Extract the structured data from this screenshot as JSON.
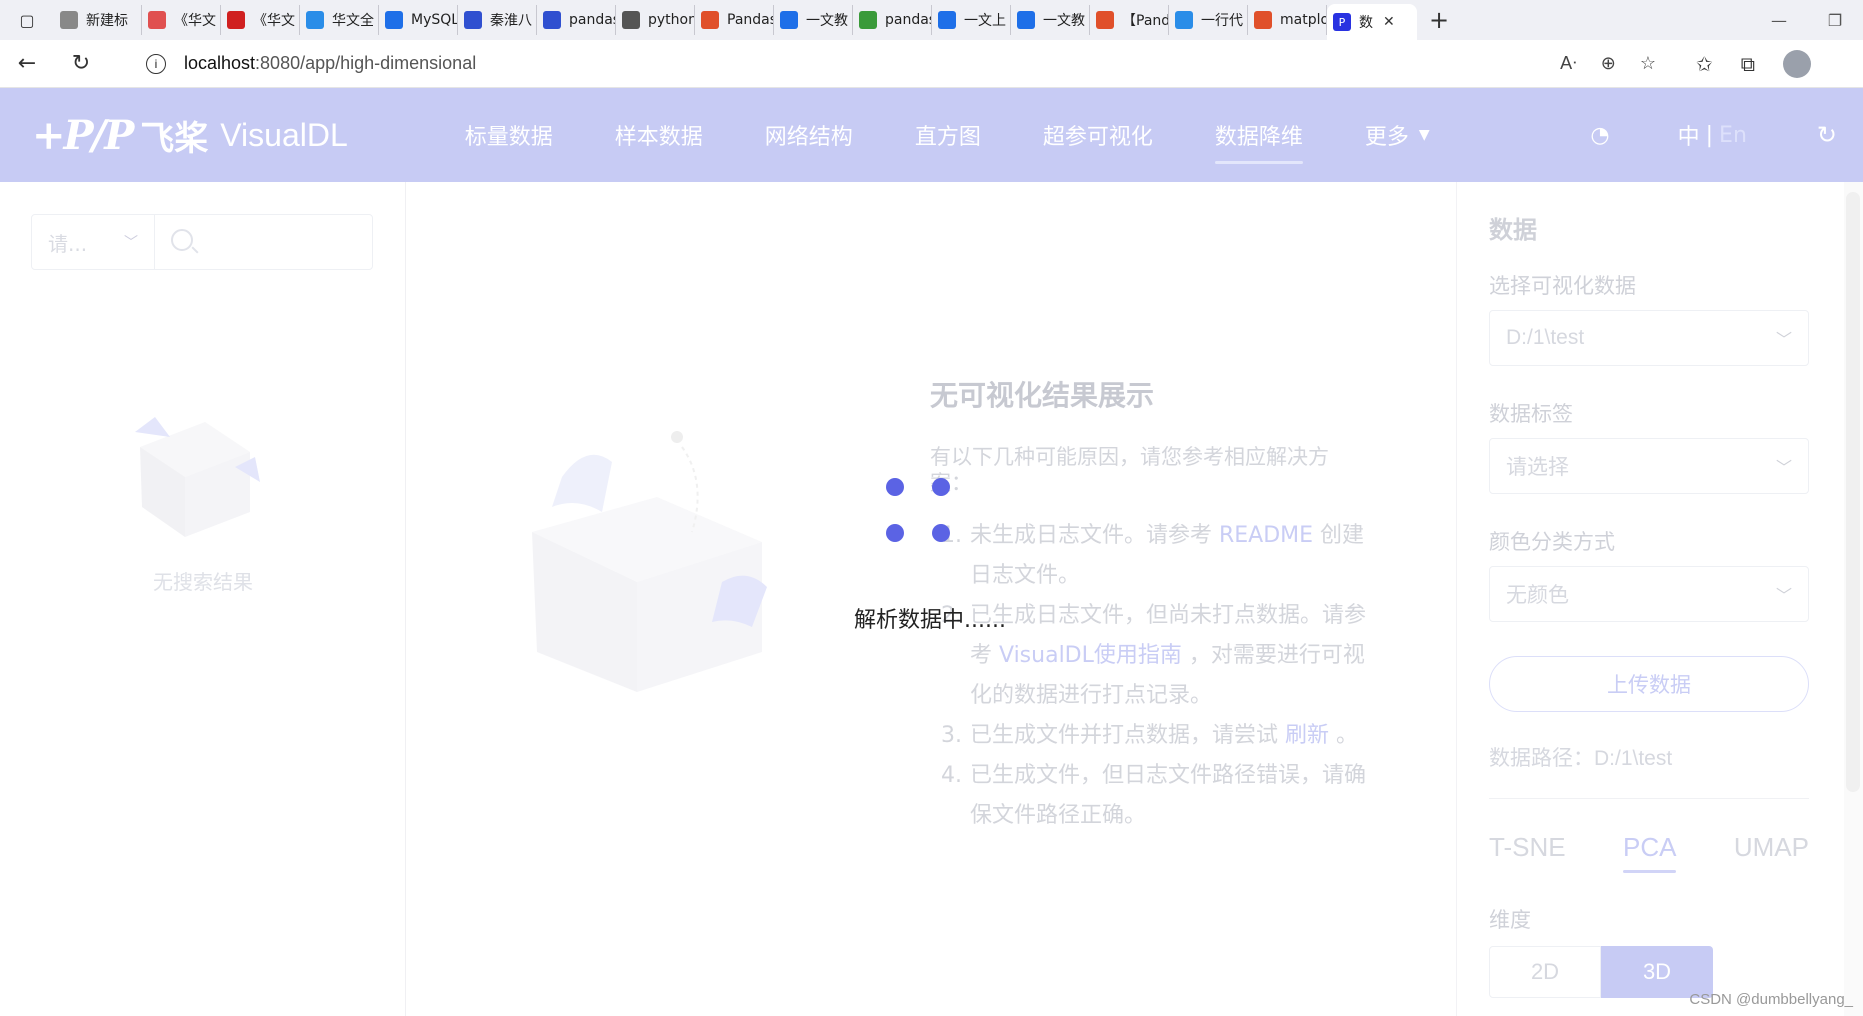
{
  "browser": {
    "tabs": [
      {
        "label": "新建标",
        "icon": "new-tab-icon",
        "color": "#888888"
      },
      {
        "label": "《华文",
        "icon": "book-icon",
        "color": "#e05050"
      },
      {
        "label": "《华文",
        "icon": "book-icon",
        "color": "#d02020"
      },
      {
        "label": "华文全",
        "icon": "cloud-icon",
        "color": "#2a8de8"
      },
      {
        "label": "MySQL",
        "icon": "zhihu-icon",
        "color": "#1e6fe8"
      },
      {
        "label": "秦淮八",
        "icon": "baidu-paw-icon",
        "color": "#3050d0"
      },
      {
        "label": "pandas",
        "icon": "baidu-paw-icon",
        "color": "#3050d0"
      },
      {
        "label": "python",
        "icon": "script-icon",
        "color": "#555555"
      },
      {
        "label": "Pandas",
        "icon": "csdn-icon",
        "color": "#e0502a"
      },
      {
        "label": "一文教",
        "icon": "zhihu-icon",
        "color": "#1e6fe8"
      },
      {
        "label": "pandas",
        "icon": "g-icon",
        "color": "#3a9a3a"
      },
      {
        "label": "一文上",
        "icon": "zhihu-icon",
        "color": "#1e6fe8"
      },
      {
        "label": "一文教",
        "icon": "zhihu-icon",
        "color": "#1e6fe8"
      },
      {
        "label": "【Pand",
        "icon": "csdn-icon",
        "color": "#e0502a"
      },
      {
        "label": "一行代",
        "icon": "cloud-icon",
        "color": "#2a8de8"
      },
      {
        "label": "matplo",
        "icon": "csdn-icon",
        "color": "#e0502a"
      }
    ],
    "active_tab": {
      "label": "数",
      "icon": "paddle-icon",
      "color": "#2932e1"
    },
    "new_tab_label": "+",
    "url_host": "localhost",
    "url_path": ":8080/app/high-dimensional"
  },
  "header": {
    "logo_mark": "+P/P",
    "brand_cn": "飞桨",
    "brand_en": "VisualDL",
    "nav": [
      {
        "label": "标量数据",
        "active": false
      },
      {
        "label": "样本数据",
        "active": false
      },
      {
        "label": "网络结构",
        "active": false
      },
      {
        "label": "直方图",
        "active": false
      },
      {
        "label": "超参可视化",
        "active": false
      },
      {
        "label": "数据降维",
        "active": true
      },
      {
        "label": "更多",
        "active": false
      }
    ],
    "lang_zh": "中",
    "lang_sep": "|",
    "lang_en": "En"
  },
  "left_panel": {
    "select_placeholder": "请...",
    "empty_text": "无搜索结果"
  },
  "main": {
    "title": "无可视化结果展示",
    "intro": "有以下几种可能原因，请您参考相应解决方案：",
    "reasons": [
      {
        "num": "1.",
        "pre": "未生成日志文件。请参考 ",
        "link": "README",
        "post": " 创建日志文件。"
      },
      {
        "num": "2.",
        "pre": "已生成日志文件，但尚未打点数据。请参考 ",
        "link": "VisualDL使用指南",
        "post": " ，对需要进行可视化的数据进行打点记录。"
      },
      {
        "num": "3.",
        "pre": "已生成文件并打点数据，请尝试 ",
        "link": "刷新",
        "post": " 。"
      },
      {
        "num": "4.",
        "pre": "已生成文件，但日志文件路径错误，请确保文件路径正确。",
        "link": "",
        "post": ""
      }
    ],
    "loading_text": "解析数据中......"
  },
  "right_panel": {
    "title": "数据",
    "select_data_label": "选择可视化数据",
    "select_data_value": "D:/1\\test",
    "label_label": "数据标签",
    "label_value": "请选择",
    "color_label": "颜色分类方式",
    "color_value": "无颜色",
    "upload_button": "上传数据",
    "data_path": "数据路径：D:/1\\test",
    "algorithms": [
      {
        "label": "T-SNE",
        "active": false
      },
      {
        "label": "PCA",
        "active": true
      },
      {
        "label": "UMAP",
        "active": false
      }
    ],
    "dimension_label": "维度",
    "dim_2d": "2D",
    "dim_3d": "3D",
    "dim_selected": "3D"
  },
  "watermark": "CSDN @dumbbellyang_",
  "colors": {
    "header_bg": "#c7cbf4",
    "accent": "#5b63e4",
    "link": "#c9cdf5"
  }
}
